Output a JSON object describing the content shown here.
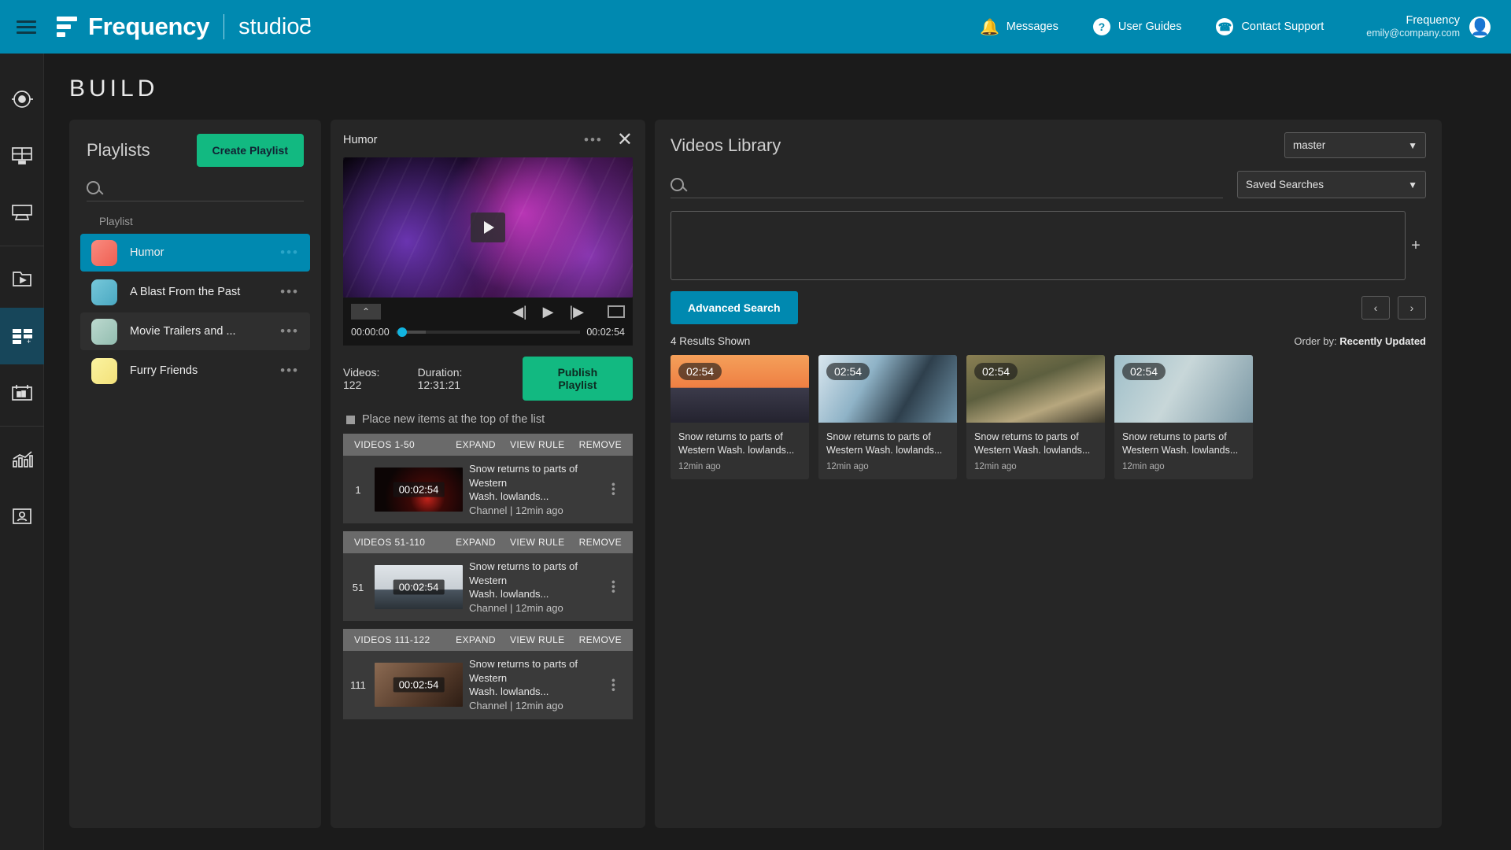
{
  "header": {
    "brand_name": "Frequency",
    "brand_sub": "studio",
    "brand_sub_mark": "5",
    "nav": [
      {
        "label": "Messages",
        "icon": "bell-icon"
      },
      {
        "label": "User Guides",
        "icon": "question-icon"
      },
      {
        "label": "Contact Support",
        "icon": "phone-icon"
      }
    ],
    "user": {
      "name": "Frequency",
      "email": "emily@company.com"
    }
  },
  "page": {
    "title": "BUILD"
  },
  "rail": {
    "items": [
      {
        "name": "live-icon",
        "active": false
      },
      {
        "name": "screen-grid-icon",
        "active": false
      },
      {
        "name": "device-icon",
        "active": false
      },
      {
        "name": "video-folder-icon",
        "active": false
      },
      {
        "name": "playlist-build-icon",
        "active": true
      },
      {
        "name": "schedule-icon",
        "active": false
      },
      {
        "name": "analytics-icon",
        "active": false
      },
      {
        "name": "account-icon",
        "active": false
      }
    ]
  },
  "playlists": {
    "title": "Playlists",
    "create_label": "Create Playlist",
    "search_placeholder": "",
    "search_value": "",
    "column_header": "Playlist",
    "menu_glyph": "•••",
    "items": [
      {
        "label": "Humor",
        "selected": true,
        "thumb": "#f4746a"
      },
      {
        "label": "A Blast From the Past",
        "selected": false,
        "thumb": "#5fb8cf"
      },
      {
        "label": "Movie Trailers and ...",
        "selected": false,
        "thumb": "#a8cfc4"
      },
      {
        "label": "Furry Friends",
        "selected": false,
        "thumb": "#f6e98a"
      }
    ]
  },
  "player": {
    "title": "Humor",
    "menu_glyph": "•••",
    "close_glyph": "✕",
    "expand_glyph": "⌃",
    "prev_glyph": "◀|",
    "play_glyph": "▶",
    "next_glyph": "|▶",
    "time_current": "00:00:00",
    "time_total": "00:02:54",
    "videos_label": "Videos: 122",
    "duration_label": "Duration: 12:31:21",
    "publish_label": "Publish Playlist",
    "place_top_label": "Place new items at the top of the list",
    "group_actions": [
      "EXPAND",
      "VIEW RULE",
      "REMOVE"
    ],
    "groups": [
      {
        "label": "VIDEOS 1-50",
        "rows": [
          {
            "index": "1",
            "duration": "00:02:54",
            "title_line1": "Snow returns to parts of Western",
            "title_line2": "Wash. lowlands...",
            "meta": "Channel | 12min ago",
            "thumb": "#2a0d0d"
          }
        ]
      },
      {
        "label": "VIDEOS 51-110",
        "rows": [
          {
            "index": "51",
            "duration": "00:02:54",
            "title_line1": "Snow returns to parts of Western",
            "title_line2": "Wash. lowlands...",
            "meta": "Channel | 12min ago",
            "thumb": "#cfd6dd"
          }
        ]
      },
      {
        "label": "VIDEOS 111-122",
        "rows": [
          {
            "index": "111",
            "duration": "00:02:54",
            "title_line1": "Snow returns to parts of Western",
            "title_line2": "Wash. lowlands...",
            "meta": "Channel | 12min ago",
            "thumb": "#6b4a3a"
          }
        ]
      }
    ]
  },
  "library": {
    "title": "Videos Library",
    "master_select": "master",
    "saved_searches_select": "Saved Searches",
    "search_placeholder": "",
    "search_value": "",
    "plus_glyph": "+",
    "advanced_search_label": "Advanced Search",
    "prev_glyph": "‹",
    "next_glyph": "›",
    "results_label": "4 Results Shown",
    "order_prefix": "Order by:",
    "order_value": "Recently Updated",
    "caret_glyph": "▼",
    "cards": [
      {
        "duration": "02:54",
        "title": "Snow returns to parts of Western Wash. lowlands...",
        "age": "12min ago",
        "img": "sunset-mountain"
      },
      {
        "duration": "02:54",
        "title": "Snow returns to parts of Western Wash. lowlands...",
        "age": "12min ago",
        "img": "ice-cave"
      },
      {
        "duration": "02:54",
        "title": "Snow returns to parts of Western Wash. lowlands...",
        "age": "12min ago",
        "img": "street-alley"
      },
      {
        "duration": "02:54",
        "title": "Snow returns to parts of Western Wash. lowlands...",
        "age": "12min ago",
        "img": "hand-photo"
      }
    ]
  },
  "colors": {
    "brand": "#0089b0",
    "green": "#12b981",
    "panel": "#262626",
    "bg": "#1b1b1b"
  }
}
